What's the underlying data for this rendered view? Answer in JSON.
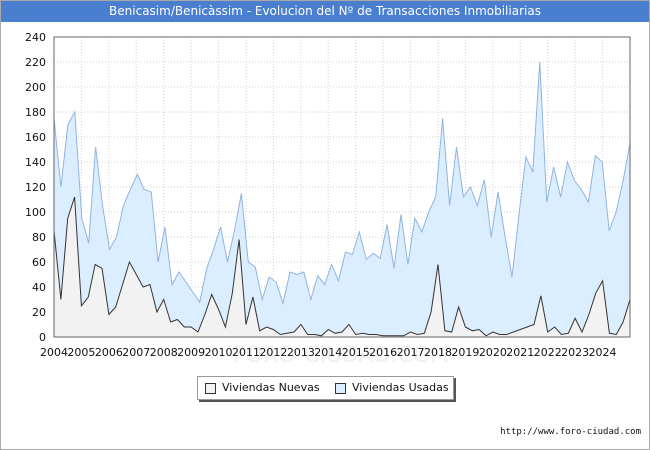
{
  "title": "Benicasim/Benicàssim - Evolucion del Nº de Transacciones Inmobiliarias",
  "source": "http://www.foro-ciudad.com",
  "watermark": "FORO-CIUDAD.COM",
  "colors": {
    "title_bg": "#4a7fd0",
    "usadas_fill": "#dbeeff",
    "usadas_line": "#8fb4e0",
    "nuevas_fill": "#f2f2f2",
    "nuevas_line": "#333333"
  },
  "chart_data": {
    "type": "area",
    "title": "Benicasim/Benicàssim - Evolucion del Nº de Transacciones Inmobiliarias",
    "xlabel": "",
    "ylabel": "",
    "ylim": [
      0,
      240
    ],
    "yticks": [
      0,
      20,
      40,
      60,
      80,
      100,
      120,
      140,
      160,
      180,
      200,
      220,
      240
    ],
    "xlim": [
      2004,
      2025
    ],
    "xticks": [
      "2004",
      "2005",
      "2006",
      "2007",
      "2008",
      "2009",
      "2010",
      "2011",
      "2012",
      "2013",
      "2014",
      "2015",
      "2016",
      "2017",
      "2018",
      "2019",
      "2020",
      "2021",
      "2022",
      "2023",
      "2024"
    ],
    "x_quarterly_start": "2004-Q1",
    "grid": true,
    "legend_position": "bottom-center",
    "series": [
      {
        "name": "Viviendas Nuevas",
        "values": [
          85,
          30,
          95,
          112,
          25,
          32,
          58,
          55,
          18,
          24,
          42,
          60,
          50,
          40,
          42,
          20,
          30,
          12,
          14,
          8,
          8,
          4,
          18,
          34,
          22,
          8,
          35,
          78,
          10,
          32,
          5,
          8,
          6,
          2,
          3,
          4,
          10,
          2,
          2,
          1,
          6,
          3,
          4,
          10,
          2,
          3,
          2,
          2,
          1,
          1,
          1,
          1,
          4,
          2,
          3,
          20,
          58,
          5,
          4,
          24,
          8,
          5,
          6,
          1,
          4,
          2,
          2,
          4,
          6,
          8,
          10,
          33,
          4,
          8,
          2,
          3,
          15,
          4,
          18,
          35,
          45,
          3,
          2,
          12,
          30
        ]
      },
      {
        "name": "Viviendas Usadas",
        "values": [
          175,
          120,
          170,
          180,
          95,
          75,
          152,
          105,
          70,
          80,
          105,
          118,
          130,
          118,
          116,
          60,
          88,
          42,
          52,
          44,
          36,
          28,
          55,
          70,
          88,
          60,
          85,
          115,
          60,
          56,
          30,
          48,
          44,
          27,
          52,
          50,
          52,
          30,
          49,
          42,
          58,
          45,
          68,
          66,
          84,
          62,
          67,
          63,
          90,
          55,
          98,
          58,
          95,
          84,
          100,
          112,
          175,
          105,
          152,
          112,
          120,
          105,
          126,
          80,
          116,
          80,
          48,
          98,
          144,
          132,
          220,
          108,
          136,
          112,
          140,
          125,
          118,
          108,
          145,
          140,
          85,
          100,
          125,
          155
        ]
      }
    ]
  }
}
